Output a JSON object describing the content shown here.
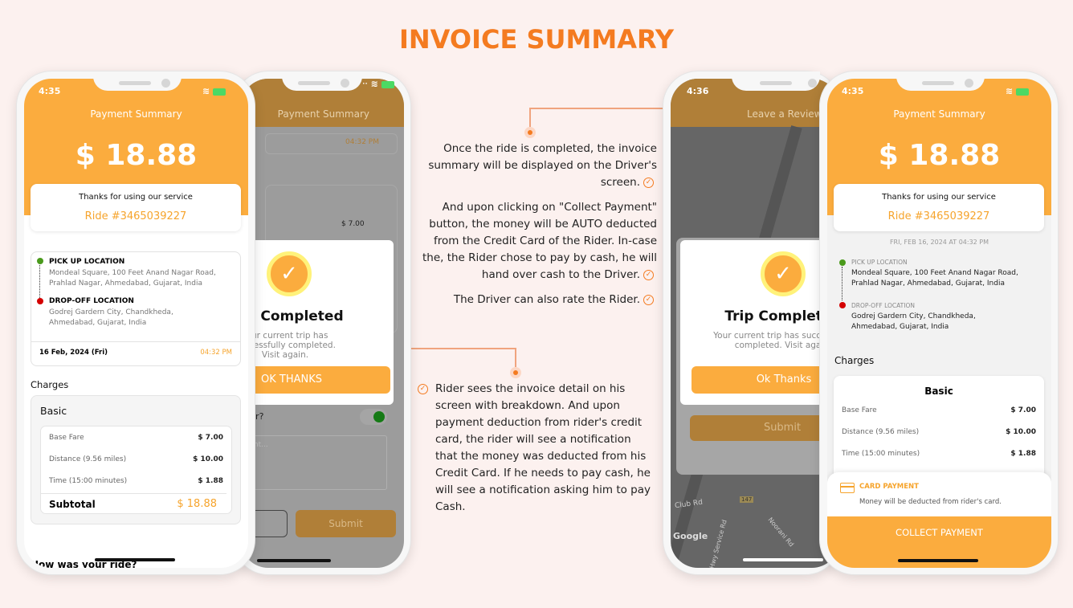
{
  "page": {
    "title": "INVOICE SUMMARY"
  },
  "colors": {
    "accent": "#f47b20",
    "brand": "#fbac3e",
    "pickup": "#4a9a1c",
    "dropoff": "#d40000"
  },
  "driver_notes": [
    "Once the ride is completed, the invoice summary will be displayed on the Driver's screen.",
    "And upon clicking on \"Collect Payment\" button, the money will be AUTO deducted from the Credit Card of the Rider. In-case the, the Rider chose to pay by cash, he will hand over cash to the Driver.",
    "The Driver can also rate the Rider."
  ],
  "rider_note": "Rider sees the invoice detail on his screen with breakdown. And upon payment deduction from rider's credit card, the rider will see a notification that the money was deducted from his Credit Card. If he needs to pay cash, he will see a notification asking him to pay Cash.",
  "rider_screen": {
    "time": "4:35",
    "header": "Payment Summary",
    "amount": "$ 18.88",
    "thanks": "Thanks for using our service",
    "ride": "Ride #3465039227",
    "pickup_label": "PICK UP LOCATION",
    "pickup": "Mondeal Square, 100 Feet Anand Nagar Road, Prahlad Nagar, Ahmedabad, Gujarat, India",
    "dropoff_label": "DROP-OFF LOCATION",
    "dropoff": "Godrej Gardern City, Chandkheda, Ahmedabad, Gujarat, India",
    "date": "16 Feb, 2024 (Fri)",
    "date_time": "04:32 PM",
    "charges": "Charges",
    "plan": "Basic",
    "rows": [
      {
        "label": "Base Fare",
        "value": "$ 7.00"
      },
      {
        "label": "Distance (9.56 miles)",
        "value": "$ 10.00"
      },
      {
        "label": "Time (15:00 minutes)",
        "value": "$ 1.88"
      }
    ],
    "subtotal_label": "Subtotal",
    "subtotal": "$ 18.88",
    "rate_prompt": "How was your ride?"
  },
  "rider_dialog": {
    "header": "Payment Summary",
    "time": "04:32 PM",
    "base_fare": "$ 7.00",
    "title": "Trip Completed",
    "message": "Your current trip has successfully completed. Visit again.",
    "ok": "OK THANKS",
    "rate_label": "Rate Driver?",
    "comment_placeholder": "Comment...",
    "submit": "Submit"
  },
  "driver_dialog": {
    "time": "4:36",
    "header": "Leave a Review",
    "title": "Trip Completed",
    "message": "Your current trip has successfully completed. Visit again.",
    "ok": "Ok Thanks",
    "submit": "Submit",
    "map_labels": [
      "Club Rd",
      "Noorani Rd",
      "Hwy Service Rd",
      "147"
    ],
    "map_brand": "Google"
  },
  "driver_screen": {
    "time": "4:35",
    "header": "Payment Summary",
    "amount": "$ 18.88",
    "thanks": "Thanks for using our service",
    "ride": "Ride #3465039227",
    "datetime": "FRI, FEB 16, 2024 AT 04:32 PM",
    "pickup_label": "PICK UP LOCATION",
    "pickup": "Mondeal Square, 100 Feet Anand Nagar Road, Prahlad Nagar, Ahmedabad, Gujarat, India",
    "dropoff_label": "DROP-OFF LOCATION",
    "dropoff": "Godrej Gardern City, Chandkheda, Ahmedabad, Gujarat, India",
    "charges": "Charges",
    "plan": "Basic",
    "rows": [
      {
        "label": "Base Fare",
        "value": "$ 7.00"
      },
      {
        "label": "Distance (9.56 miles)",
        "value": "$ 10.00"
      },
      {
        "label": "Time (15:00 minutes)",
        "value": "$ 1.88"
      }
    ],
    "payment_method": "CARD PAYMENT",
    "payment_note": "Money will be deducted from rider's card.",
    "collect": "COLLECT PAYMENT"
  }
}
